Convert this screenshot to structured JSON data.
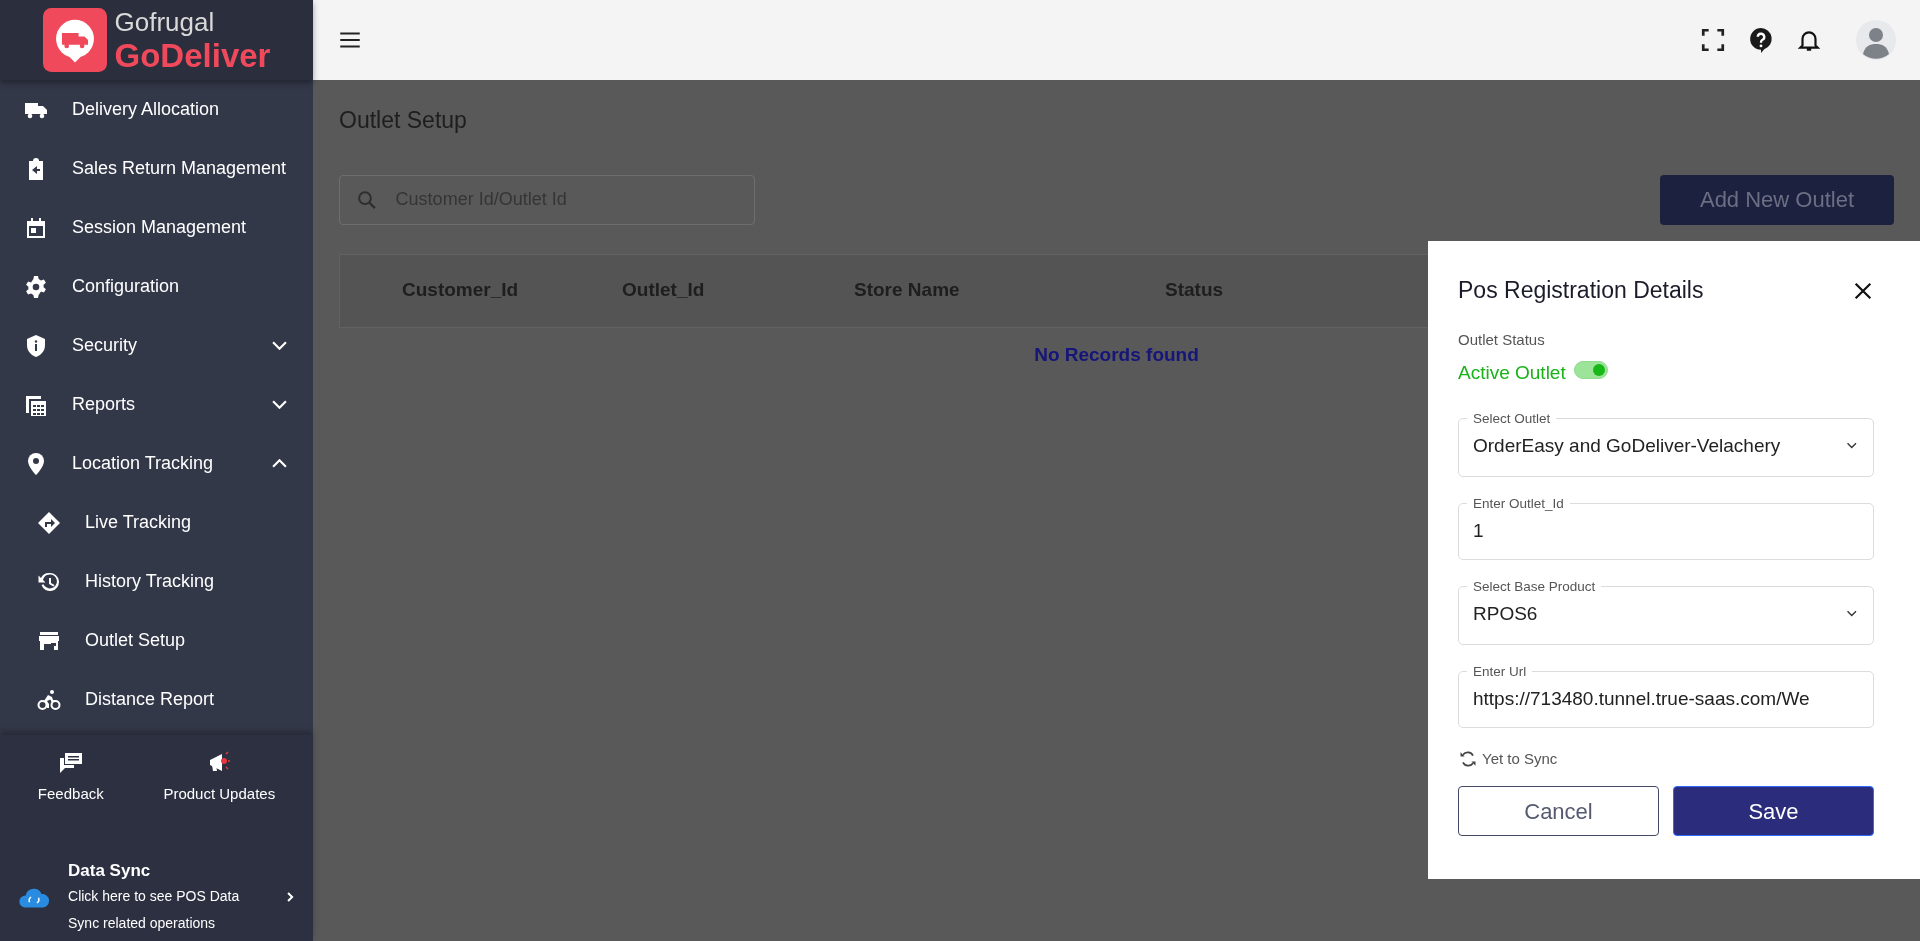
{
  "brand": {
    "line1": "Gofrugal",
    "line2": "GoDeliver"
  },
  "sidebar": {
    "items": [
      {
        "label": "Delivery Allocation"
      },
      {
        "label": "Sales Return Management"
      },
      {
        "label": "Session Management"
      },
      {
        "label": "Configuration"
      },
      {
        "label": "Security",
        "expanded": false
      },
      {
        "label": "Reports",
        "expanded": false
      },
      {
        "label": "Location Tracking",
        "expanded": true,
        "children": [
          {
            "label": "Live Tracking"
          },
          {
            "label": "History Tracking"
          },
          {
            "label": "Outlet Setup"
          },
          {
            "label": "Distance Report"
          }
        ]
      }
    ]
  },
  "footer_links": [
    {
      "label": "Feedback"
    },
    {
      "label": "Product Updates"
    }
  ],
  "data_sync": {
    "title": "Data Sync",
    "description": "Click here to see POS Data Sync related operations"
  },
  "page": {
    "title": "Outlet Setup",
    "search": {
      "placeholder": "Customer Id/Outlet Id"
    },
    "add_button": "Add New Outlet",
    "table": {
      "columns": [
        "Customer_Id",
        "Outlet_Id",
        "Store Name",
        "Status"
      ],
      "empty_message": "No Records found"
    }
  },
  "dialog": {
    "title": "Pos Registration Details",
    "status_label": "Outlet Status",
    "status_text": "Active Outlet",
    "active": true,
    "fields": [
      {
        "kind": "select",
        "label": "Select Outlet",
        "value": "OrderEasy and GoDeliver-Velachery"
      },
      {
        "kind": "text",
        "label": "Enter Outlet_Id",
        "value": "1"
      },
      {
        "kind": "select",
        "label": "Select Base Product",
        "value": "RPOS6"
      },
      {
        "kind": "text",
        "label": "Enter Url",
        "value": "https://713480.tunnel.true-saas.com/We"
      }
    ],
    "sync_status": "Yet to Sync",
    "cancel": "Cancel",
    "save": "Save"
  }
}
